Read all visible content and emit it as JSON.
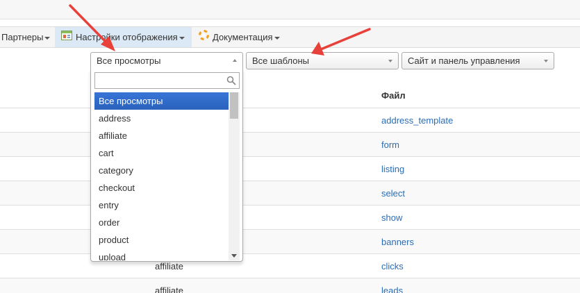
{
  "menu": {
    "partners_label": "Партнеры",
    "display_settings_label": "Настройки отображения",
    "documentation_label": "Документация"
  },
  "filters": {
    "views_selected": "Все просмотры",
    "templates_selected": "Все шаблоны",
    "panel_selected": "Сайт и панель управления"
  },
  "dropdown": {
    "search_value": "",
    "items": [
      "Все просмотры",
      "address",
      "affiliate",
      "cart",
      "category",
      "checkout",
      "entry",
      "order",
      "product",
      "upload"
    ]
  },
  "table": {
    "file_header": "Файл",
    "rows": [
      {
        "view": "",
        "file": "address_template"
      },
      {
        "view": "",
        "file": "form"
      },
      {
        "view": "",
        "file": "listing"
      },
      {
        "view": "",
        "file": "select"
      },
      {
        "view": "",
        "file": "show"
      },
      {
        "view": "",
        "file": "banners"
      },
      {
        "view": "affiliate",
        "file": "clicks"
      },
      {
        "view": "affiliate",
        "file": "leads"
      }
    ]
  },
  "colors": {
    "accent": "#2a6db5",
    "highlight": "#3875d7",
    "annotation_arrow": "#e8413a"
  }
}
